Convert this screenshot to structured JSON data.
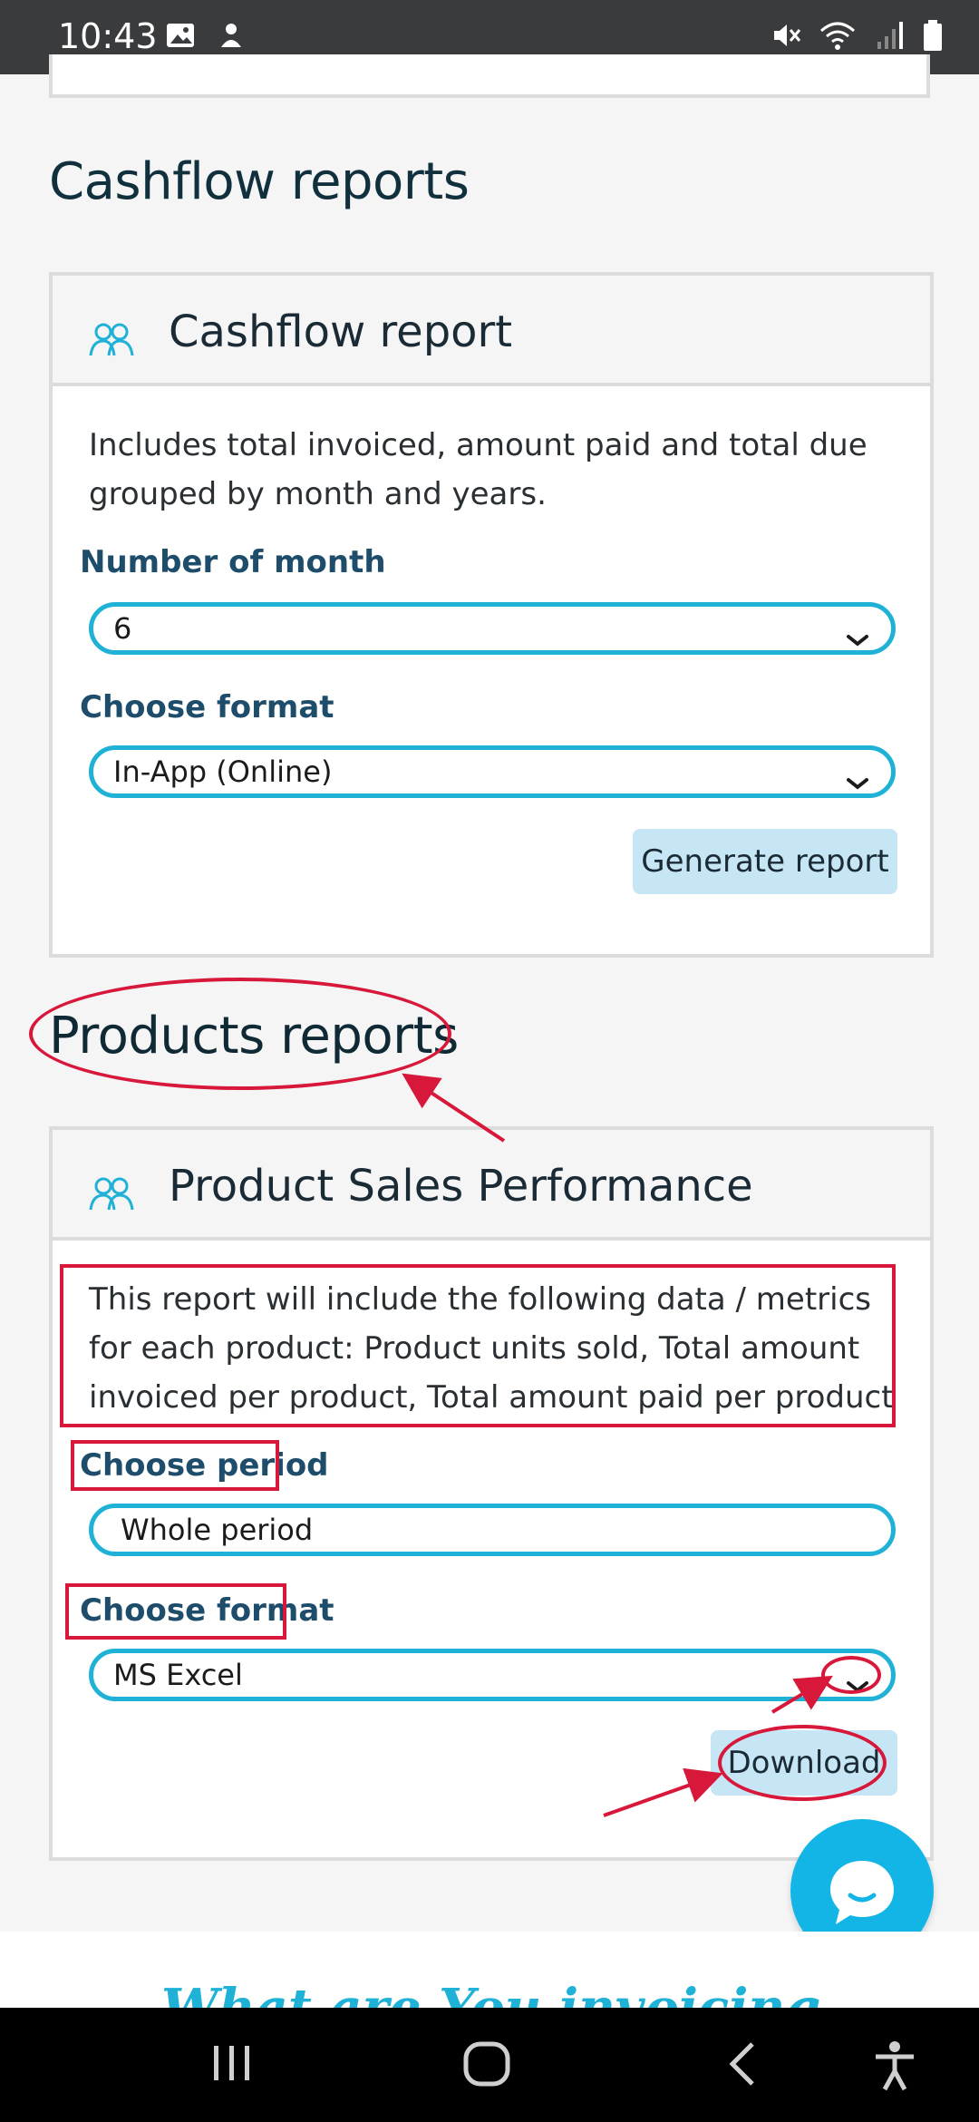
{
  "status_bar": {
    "time": "10:43"
  },
  "cashflow": {
    "section_title": "Cashflow reports",
    "card_title": "Cashflow report",
    "description": "Includes total invoiced, amount paid and total due grouped by month and years.",
    "month_label": "Number of month",
    "month_value": "6",
    "format_label": "Choose format",
    "format_value": "In-App (Online)",
    "generate_button": "Generate report"
  },
  "products": {
    "section_title": "Products reports",
    "card_title": "Product Sales Performance",
    "description": "This report will include the following data / metrics for each product: Product units sold, Total amount invoiced per product, Total amount paid per product",
    "period_label": "Choose period",
    "period_value": "Whole period",
    "format_label": "Choose format",
    "format_value": "MS Excel",
    "download_button": "Download"
  },
  "footer": {
    "tagline": "What are You invoicing today?"
  },
  "colors": {
    "accent": "#1fb2d6",
    "annotation": "#d8183a",
    "button": "#c6e6f5",
    "chat": "#12b5e6"
  },
  "icons": [
    "image-icon",
    "notification-icon",
    "mute-icon",
    "wifi-icon",
    "signal-icon",
    "battery-icon",
    "users-icon",
    "chevron-down-icon",
    "chat-icon",
    "recents-icon",
    "home-icon",
    "back-icon",
    "accessibility-icon"
  ]
}
